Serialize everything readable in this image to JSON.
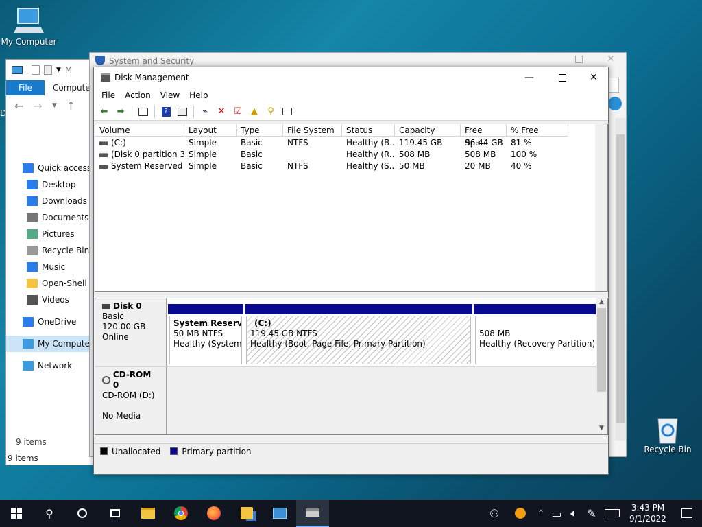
{
  "desktop": {
    "my_computer_label": "My Computer",
    "recycle_bin_label": "Recycle Bin"
  },
  "explorer": {
    "ribbon_file": "File",
    "ribbon_computer": "Computer",
    "title_fragment": "M",
    "nav": [
      {
        "label": "Quick access",
        "icon": "star-icon"
      },
      {
        "label": "Desktop",
        "icon": "desktop-icon"
      },
      {
        "label": "Downloads",
        "icon": "download-icon"
      },
      {
        "label": "Documents",
        "icon": "documents-icon"
      },
      {
        "label": "Pictures",
        "icon": "pictures-icon"
      },
      {
        "label": "Recycle Bin",
        "icon": "recycle-bin-icon"
      },
      {
        "label": "Music",
        "icon": "music-icon"
      },
      {
        "label": "Open-Shell M",
        "icon": "folder-icon"
      },
      {
        "label": "Videos",
        "icon": "videos-icon"
      },
      {
        "label": "OneDrive",
        "icon": "cloud-icon"
      },
      {
        "label": "My Computer",
        "icon": "computer-icon"
      },
      {
        "label": "Network",
        "icon": "network-icon"
      }
    ],
    "items_count_1": "9 items",
    "items_count_2": "9 items",
    "left_edge_char": "D"
  },
  "back_window": {
    "title": "System and Security"
  },
  "disk_mgmt": {
    "title": "Disk Management",
    "menu": [
      "File",
      "Action",
      "View",
      "Help"
    ],
    "columns": [
      "Volume",
      "Layout",
      "Type",
      "File System",
      "Status",
      "Capacity",
      "Free Spa...",
      "% Free"
    ],
    "rows": [
      [
        "(C:)",
        "Simple",
        "Basic",
        "NTFS",
        "Healthy (B...",
        "119.45 GB",
        "96.44 GB",
        "81 %"
      ],
      [
        "(Disk 0 partition 3)",
        "Simple",
        "Basic",
        "",
        "Healthy (R...",
        "508 MB",
        "508 MB",
        "100 %"
      ],
      [
        "System Reserved",
        "Simple",
        "Basic",
        "NTFS",
        "Healthy (S...",
        "50 MB",
        "20 MB",
        "40 %"
      ]
    ],
    "disk0": {
      "name": "Disk 0",
      "type": "Basic",
      "size": "120.00 GB",
      "state": "Online"
    },
    "partitions": [
      {
        "name": "System Reserved",
        "size": "50 MB NTFS",
        "status": "Healthy (System, A"
      },
      {
        "name": "(C:)",
        "size": "119.45 GB NTFS",
        "status": "Healthy (Boot, Page File, Primary Partition)"
      },
      {
        "name": "",
        "size": "508 MB",
        "status": "Healthy (Recovery Partition)"
      }
    ],
    "cdrom": {
      "name": "CD-ROM 0",
      "type": "CD-ROM (D:)",
      "state": "No Media"
    },
    "legend": {
      "unallocated": "Unallocated",
      "primary": "Primary partition"
    },
    "colors": {
      "primary_bar": "#0a0a8f",
      "unallocated": "#000000"
    }
  },
  "taskbar": {
    "time": "3:43 PM",
    "date": "9/1/2022"
  }
}
